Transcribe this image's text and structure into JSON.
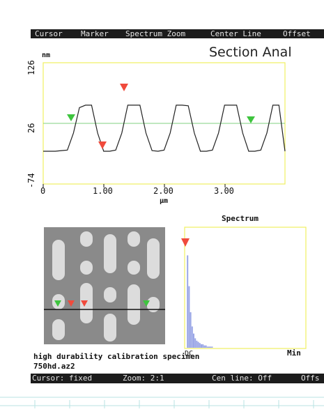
{
  "menu": [
    "Cursor",
    "Marker",
    "Spectrum Zoom",
    "Center Line",
    "Offset"
  ],
  "title": "Section Anal",
  "section_chart": {
    "y_unit": "nm",
    "y_ticks": [
      "126",
      "26",
      "-74"
    ],
    "x_ticks": [
      "0",
      "1.00",
      "2.00",
      "3.00"
    ],
    "x_unit": "µm"
  },
  "spectrum": {
    "title": "Spectrum",
    "x_left": "DC",
    "x_right": "Min"
  },
  "caption_line1": "high durability calibration specimen",
  "caption_line2": "750hd.az2",
  "status": {
    "cursor": "Cursor: fixed",
    "zoom": "Zoom: 2:1",
    "cen_line": "Cen line: Off",
    "offset": "Offs"
  },
  "colors": {
    "marker_red": "#f04a3c",
    "marker_green": "#3ec43e",
    "plot_frame": "#f0f060",
    "centerline": "#7fd27f",
    "spectrum_fill": "#9aa6e6"
  },
  "chart_data": [
    {
      "type": "line",
      "x": [
        0,
        0.1,
        0.2,
        0.3,
        0.4,
        0.5,
        0.6,
        0.7,
        0.8,
        0.9,
        1.0,
        1.1,
        1.2,
        1.3,
        1.4,
        1.5,
        1.6,
        1.7,
        1.8,
        1.9,
        2.0,
        2.1,
        2.2,
        2.3,
        2.4,
        2.5,
        2.6,
        2.7,
        2.8,
        2.9,
        3.0,
        3.1,
        3.2,
        3.3,
        3.4,
        3.5,
        3.6,
        3.7,
        3.8,
        3.9,
        4.0
      ],
      "y": [
        -20,
        -20,
        -20,
        -19,
        -18,
        10,
        52,
        56,
        56,
        10,
        -20,
        -20,
        -18,
        10,
        56,
        56,
        56,
        10,
        -19,
        -20,
        -18,
        10,
        56,
        56,
        55,
        10,
        -20,
        -20,
        -18,
        10,
        56,
        56,
        56,
        10,
        -20,
        -20,
        -18,
        10,
        56,
        56,
        -20
      ],
      "xlabel": "µm",
      "ylabel": "nm",
      "xlim": [
        0,
        4.0
      ],
      "ylim": [
        -74,
        126
      ],
      "centerline_y": 26
    },
    {
      "type": "bar",
      "title": "Spectrum",
      "values": [
        0,
        78,
        52,
        30,
        18,
        12,
        8,
        6,
        5,
        4,
        3,
        3,
        2,
        2,
        1,
        1,
        1,
        1,
        0,
        0
      ],
      "ylim": [
        0,
        100
      ]
    }
  ]
}
